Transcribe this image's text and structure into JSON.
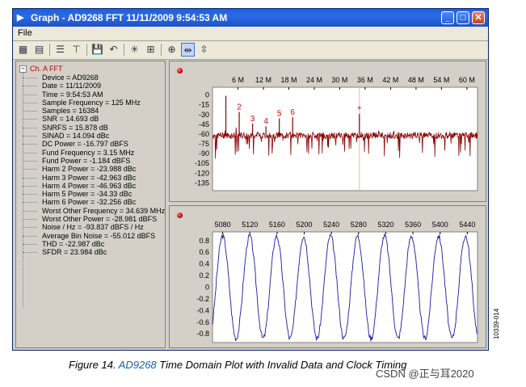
{
  "window": {
    "title": "Graph - AD9268 FFT 11/11/2009 9:54:53 AM",
    "minimize_label": "_",
    "maximize_label": "□",
    "close_label": "✕"
  },
  "menu": {
    "file_label": "File"
  },
  "toolbar": {
    "icons": [
      "chart-icon",
      "report-icon",
      "list-icon",
      "layout-icon",
      "save-icon",
      "undo-icon",
      "star-icon",
      "grid-icon",
      "crosshair-icon",
      "zoom-x-icon",
      "zoom-y-icon"
    ],
    "glyphs": [
      "▦",
      "▤",
      "☰",
      "⊤",
      "💾",
      "↶",
      "✳",
      "⊞",
      "⊕",
      "⇹",
      "⇳"
    ]
  },
  "tree": {
    "root_label": "Ch. A FFT",
    "expander": "−",
    "items": [
      "Device = AD9268",
      "Date = 11/11/2009",
      "Time = 9:54:53 AM",
      "Sample Frequency = 125 MHz",
      "Samples = 16384",
      "SNR = 14.693 dB",
      "SNRFS = 15.878 dB",
      "SINAD = 14.094 dBc",
      "DC Power = -16.797 dBFS",
      "Fund Frequency = 3.15 MHz",
      "Fund Power = -1.184 dBFS",
      "Harm 2 Power = -23.988 dBc",
      "Harm 3 Power = -42.963 dBc",
      "Harm 4 Power = -46.963 dBc",
      "Harm 5 Power = -34.33 dBc",
      "Harm 6 Power = -32.256 dBc",
      "Worst Other Frequency = 34.639 MHz",
      "Worst Other Power = -28.981 dBFS",
      "Noise / Hz = -93.837 dBFS / Hz",
      "Average Bin Noise = -55.012 dBFS",
      "THD = -22.987 dBc",
      "SFDR = 23.984 dBc"
    ]
  },
  "chart_data": [
    {
      "type": "line",
      "x_ticks": [
        "6 M",
        "12 M",
        "18 M",
        "24 M",
        "30 M",
        "36 M",
        "42 M",
        "48 M",
        "54 M",
        "60 M"
      ],
      "x_tick_values": [
        6,
        12,
        18,
        24,
        30,
        36,
        42,
        48,
        54,
        60
      ],
      "xlim": [
        0,
        62.5
      ],
      "y_ticks": [
        "0",
        "-15",
        "-30",
        "-45",
        "-60",
        "-75",
        "-90",
        "-105",
        "-120",
        "-135"
      ],
      "y_tick_values": [
        0,
        -15,
        -30,
        -45,
        -60,
        -75,
        -90,
        -105,
        -120,
        -135
      ],
      "ylim": [
        -147,
        12
      ],
      "color": "#8b0000",
      "noise_floor": -62,
      "peaks": [
        {
          "x": 3.15,
          "y": -1.2
        },
        {
          "x": 6.3,
          "y": -26
        },
        {
          "x": 9.45,
          "y": -44
        },
        {
          "x": 12.6,
          "y": -48
        },
        {
          "x": 15.75,
          "y": -36
        },
        {
          "x": 18.9,
          "y": -34
        },
        {
          "x": 34.64,
          "y": -29
        }
      ],
      "harmonic_labels": [
        {
          "text": "2",
          "x": 6.3,
          "y": -22
        },
        {
          "text": "3",
          "x": 9.45,
          "y": -40
        },
        {
          "text": "4",
          "x": 12.6,
          "y": -44
        },
        {
          "text": "5",
          "x": 15.75,
          "y": -32
        },
        {
          "text": "6",
          "x": 18.9,
          "y": -30
        },
        {
          "text": "+",
          "x": 34.64,
          "y": -24
        }
      ],
      "grid": false
    },
    {
      "type": "line",
      "x_ticks": [
        "5080",
        "5120",
        "5160",
        "5200",
        "5240",
        "5280",
        "5320",
        "5360",
        "5400",
        "5440"
      ],
      "x_tick_values": [
        5080,
        5120,
        5160,
        5200,
        5240,
        5280,
        5320,
        5360,
        5400,
        5440
      ],
      "xlim": [
        5065,
        5455
      ],
      "y_ticks": [
        "0.8",
        "0.6",
        "0.4",
        "0.2",
        "0",
        "-0.2",
        "-0.4",
        "-0.6",
        "-0.8"
      ],
      "y_tick_values": [
        0.8,
        0.6,
        0.4,
        0.2,
        0,
        -0.2,
        -0.4,
        -0.6,
        -0.8
      ],
      "ylim": [
        -0.95,
        0.95
      ],
      "color": "#1a1aa0",
      "amplitude": 0.88,
      "period": 39.7,
      "grid": false
    }
  ],
  "caption": {
    "prefix": "Figure 14. ",
    "link": "AD9268",
    "suffix": " Time Domain Plot with Invalid Data and Clock Timing"
  },
  "figure_number": "10339-014",
  "watermark": "CSDN @正与耳2020"
}
